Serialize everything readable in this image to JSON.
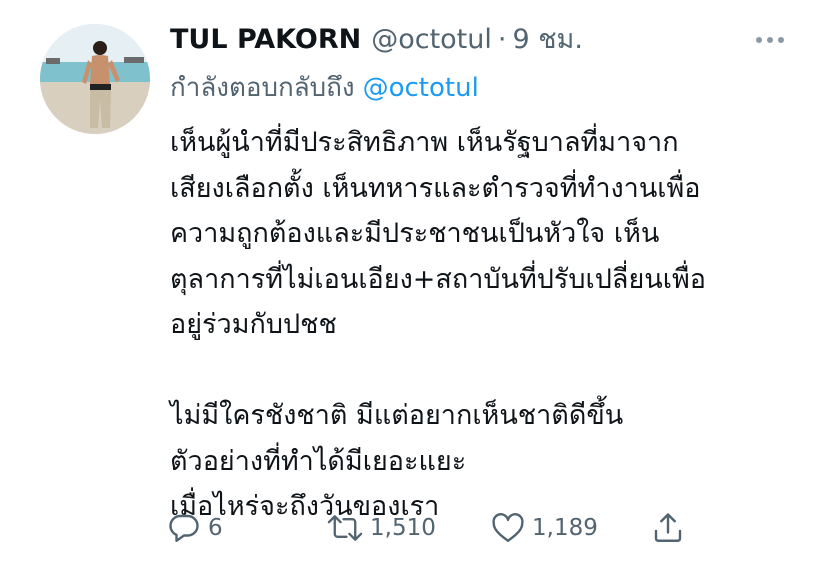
{
  "tweet": {
    "author_name": "TUL PAKORN",
    "author_handle": "@octotul",
    "separator": "·",
    "time": "9 ชม.",
    "reply_label": "กำลังตอบกลับถึง",
    "reply_mention": "@octotul",
    "body_lines": [
      "เห็นผู้นำที่มีประสิทธิภาพ เห็นรัฐบาลที่มาจาก",
      "เสียงเลือกตั้ง เห็นทหารและตำรวจที่ทำงานเพื่อ",
      "ความถูกต้องและมีประชาชนเป็นหัวใจ เห็น",
      "ตุลาการที่ไม่เอนเอียง+สถาบันที่ปรับเปลี่ยนเพื่อ",
      "อยู่ร่วมกับปชช",
      "",
      "ไม่มีใครชังชาติ มีแต่อยากเห็นชาติดีขึ้น",
      "ตัวอย่างที่ทำได้มีเยอะแยะ",
      "เมื่อไหร่จะถึงวันของเรา"
    ],
    "replies": "6",
    "retweets": "1,510",
    "likes": "1,189"
  },
  "icons": {
    "more": "more-dots-icon",
    "reply": "reply-bubble-icon",
    "retweet": "retweet-icon",
    "like": "heart-icon",
    "share": "share-icon"
  },
  "colors": {
    "text": "#0f1419",
    "secondary": "#536471",
    "link": "#1d9bf0"
  }
}
